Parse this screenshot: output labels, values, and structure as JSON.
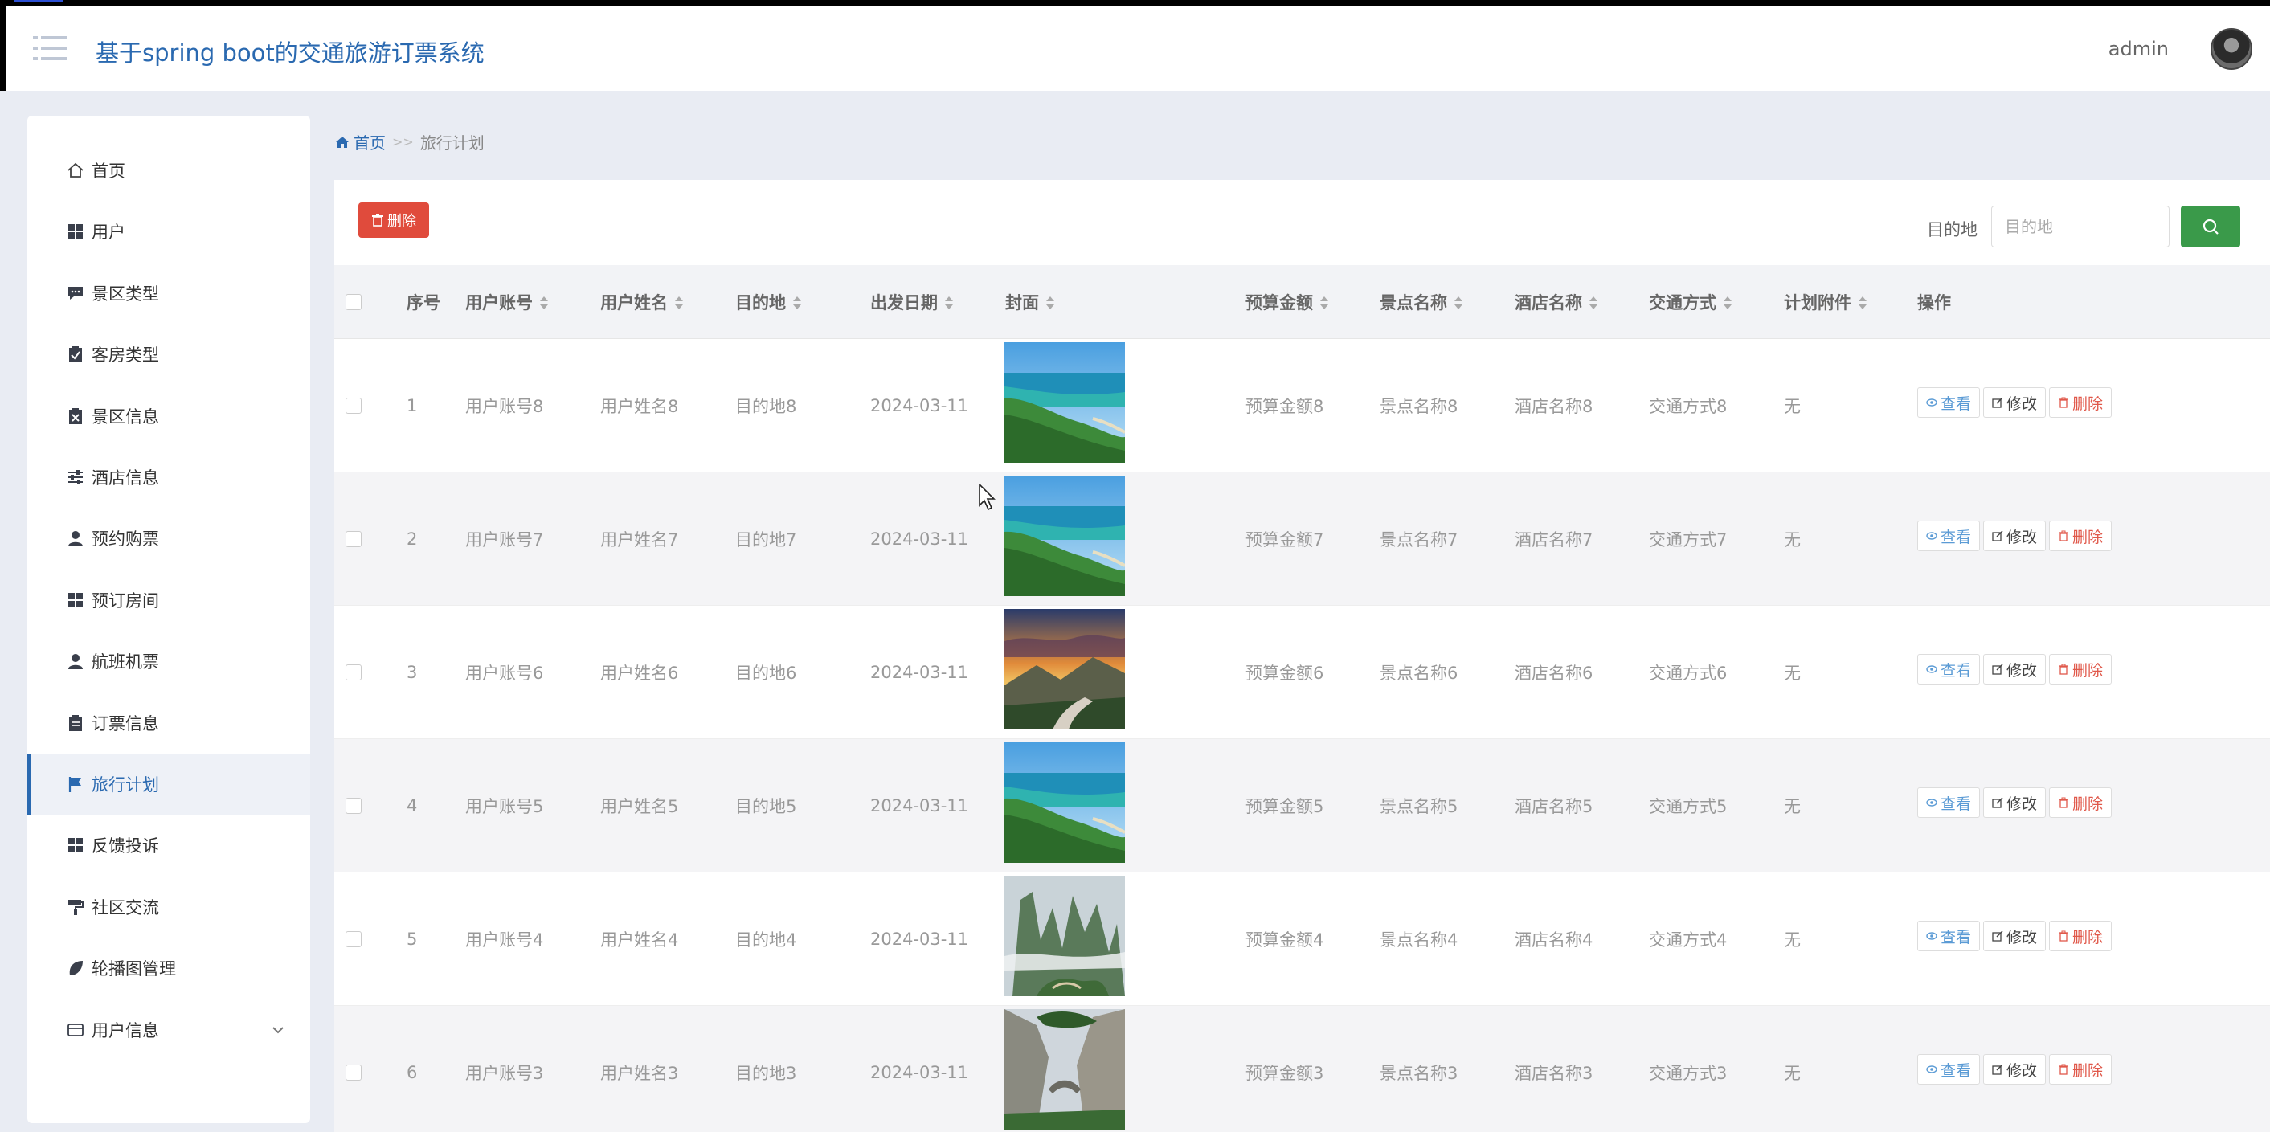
{
  "header": {
    "title": "基于spring boot的交通旅游订票系统",
    "user": "admin"
  },
  "sidebar": {
    "items": [
      {
        "label": "首页",
        "icon": "home-icon"
      },
      {
        "label": "用户",
        "icon": "grid-icon"
      },
      {
        "label": "景区类型",
        "icon": "comment-icon"
      },
      {
        "label": "客房类型",
        "icon": "clipboard-check-icon"
      },
      {
        "label": "景区信息",
        "icon": "clipboard-x-icon"
      },
      {
        "label": "酒店信息",
        "icon": "sliders-icon"
      },
      {
        "label": "预约购票",
        "icon": "user-icon"
      },
      {
        "label": "预订房间",
        "icon": "grid-icon"
      },
      {
        "label": "航班机票",
        "icon": "user-icon"
      },
      {
        "label": "订票信息",
        "icon": "clipboard-icon"
      },
      {
        "label": "旅行计划",
        "icon": "flag-icon",
        "active": true
      },
      {
        "label": "反馈投诉",
        "icon": "grid-icon"
      },
      {
        "label": "社区交流",
        "icon": "paint-roller-icon"
      },
      {
        "label": "轮播图管理",
        "icon": "leaf-icon"
      },
      {
        "label": "用户信息",
        "icon": "card-icon",
        "expandable": true
      }
    ]
  },
  "breadcrumb": {
    "home": "首页",
    "separator": ">>",
    "current": "旅行计划"
  },
  "toolbar": {
    "delete_label": "删除",
    "search_label": "目的地",
    "search_placeholder": "目的地"
  },
  "table": {
    "columns": [
      "序号",
      "用户账号",
      "用户姓名",
      "目的地",
      "出发日期",
      "封面",
      "预算金额",
      "景点名称",
      "酒店名称",
      "交通方式",
      "计划附件",
      "操作"
    ],
    "rows": [
      {
        "index": "1",
        "account": "用户账号8",
        "name": "用户姓名8",
        "destination": "目的地8",
        "date": "2024-03-11",
        "cover": "coast",
        "budget": "预算金额8",
        "spot": "景点名称8",
        "hotel": "酒店名称8",
        "transport": "交通方式8",
        "attachment": "无"
      },
      {
        "index": "2",
        "account": "用户账号7",
        "name": "用户姓名7",
        "destination": "目的地7",
        "date": "2024-03-11",
        "cover": "coast",
        "budget": "预算金额7",
        "spot": "景点名称7",
        "hotel": "酒店名称7",
        "transport": "交通方式7",
        "attachment": "无"
      },
      {
        "index": "3",
        "account": "用户账号6",
        "name": "用户姓名6",
        "destination": "目的地6",
        "date": "2024-03-11",
        "cover": "sunset",
        "budget": "预算金额6",
        "spot": "景点名称6",
        "hotel": "酒店名称6",
        "transport": "交通方式6",
        "attachment": "无"
      },
      {
        "index": "4",
        "account": "用户账号5",
        "name": "用户姓名5",
        "destination": "目的地5",
        "date": "2024-03-11",
        "cover": "coast",
        "budget": "预算金额5",
        "spot": "景点名称5",
        "hotel": "酒店名称5",
        "transport": "交通方式5",
        "attachment": "无"
      },
      {
        "index": "5",
        "account": "用户账号4",
        "name": "用户姓名4",
        "destination": "目的地4",
        "date": "2024-03-11",
        "cover": "mist",
        "budget": "预算金额4",
        "spot": "景点名称4",
        "hotel": "酒店名称4",
        "transport": "交通方式4",
        "attachment": "无"
      },
      {
        "index": "6",
        "account": "用户账号3",
        "name": "用户姓名3",
        "destination": "目的地3",
        "date": "2024-03-11",
        "cover": "cliff",
        "budget": "预算金额3",
        "spot": "景点名称3",
        "hotel": "酒店名称3",
        "transport": "交通方式3",
        "attachment": "无"
      }
    ],
    "actions": {
      "view": "查看",
      "edit": "修改",
      "delete": "删除"
    }
  },
  "colors": {
    "brand_blue": "#2a69b0",
    "danger_red": "#e04b3c",
    "search_green": "#3a9a4a"
  }
}
